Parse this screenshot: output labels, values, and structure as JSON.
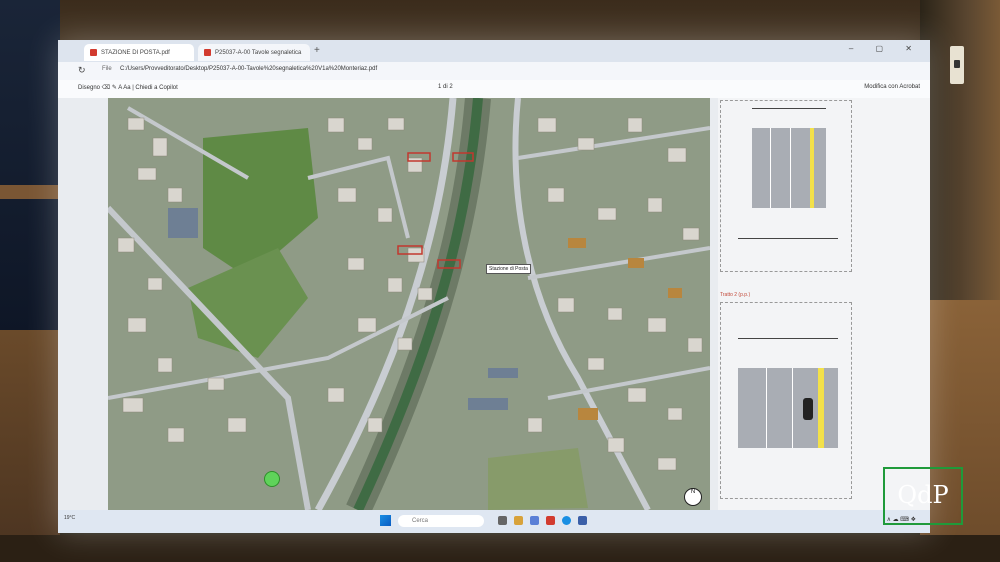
{
  "browser": {
    "tabs": [
      {
        "label": "STAZIONE DI POSTA.pdf"
      },
      {
        "label": "P25037-A-00 Tavole segnaletica"
      }
    ],
    "new_tab": "+",
    "window_controls": "– ▢ ✕",
    "file_label": "File",
    "url": "C:/Users/Provveditorato/Desktop/P25037-A-00-Tavole%20segnaletica%20V1a%20Monteriaz.pdf"
  },
  "pdf_toolbar": {
    "tools": "Disegno  ⌫  ✎  A  Aa  |  Chiedi a Copilot",
    "page": "1  di 2",
    "edit_with": "Modifica con Acrobat"
  },
  "map": {
    "station_label": "Stazione di Posta",
    "compass": "N"
  },
  "sections": {
    "section2_title": "Tratto 2 (p.p.)"
  },
  "taskbar": {
    "search_placeholder": "Cerca",
    "weather": "19°C",
    "tray": "∧  ☁  ⌨  ❖"
  },
  "watermark": {
    "text": "QdP"
  },
  "colors": {
    "map_base": "#8d9a85",
    "road_gray": "#a9adb4",
    "lane_yellow": "#f3e14a",
    "stop_green": "#5fd35a",
    "logo_green": "#1f9a3a"
  }
}
